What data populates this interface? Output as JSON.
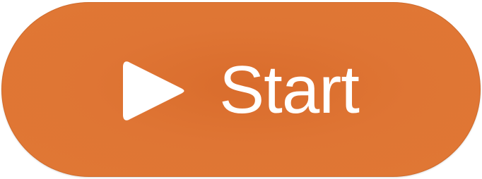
{
  "button": {
    "label": "Start",
    "icon": "play-icon",
    "background_color": "#df7534",
    "text_color": "#ffffff"
  }
}
